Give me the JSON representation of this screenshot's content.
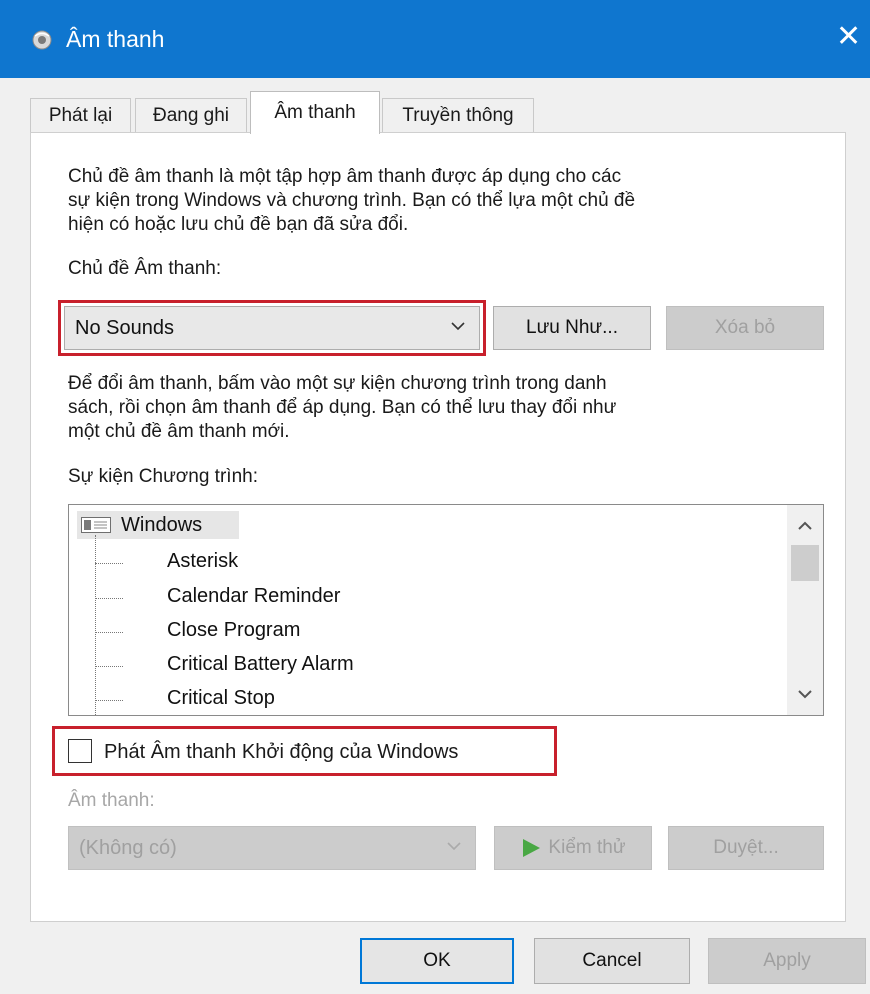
{
  "window": {
    "title": "Âm thanh"
  },
  "tabs": [
    {
      "label": "Phát lại"
    },
    {
      "label": "Đang ghi"
    },
    {
      "label": "Âm thanh"
    },
    {
      "label": "Truyền thông"
    }
  ],
  "active_tab": "Âm thanh",
  "intro": {
    "line1": "Chủ đề âm thanh là một tập hợp âm thanh được áp dụng cho các",
    "line2": "sự kiện trong Windows và chương trình. Bạn có thể lựa một chủ đề",
    "line3": "hiện có hoặc lưu chủ đề bạn đã sửa đổi."
  },
  "scheme": {
    "label": "Chủ đề Âm thanh:",
    "value": "No Sounds",
    "save_as": "Lưu Như...",
    "delete": "Xóa bỏ"
  },
  "instructions": {
    "line1": "Để đổi âm thanh, bấm vào một sự kiện chương trình trong danh",
    "line2": "sách, rồi chọn âm thanh để áp dụng. Bạn có thể lưu thay đổi như",
    "line3": "một chủ đề âm thanh mới."
  },
  "events": {
    "label": "Sự kiện Chương trình:",
    "group": "Windows",
    "items": [
      "Asterisk",
      "Calendar Reminder",
      "Close Program",
      "Critical Battery Alarm",
      "Critical Stop"
    ]
  },
  "startup": {
    "label": "Phát Âm thanh Khởi động của Windows",
    "checked": false
  },
  "sound": {
    "label": "Âm thanh:",
    "value": "(Không có)",
    "test": "Kiểm thử",
    "browse": "Duyệt..."
  },
  "footer": {
    "ok": "OK",
    "cancel": "Cancel",
    "apply": "Apply"
  },
  "colors": {
    "titlebar": "#0f76cf",
    "highlight_box": "#c8202c",
    "play_icon": "#49a844"
  }
}
